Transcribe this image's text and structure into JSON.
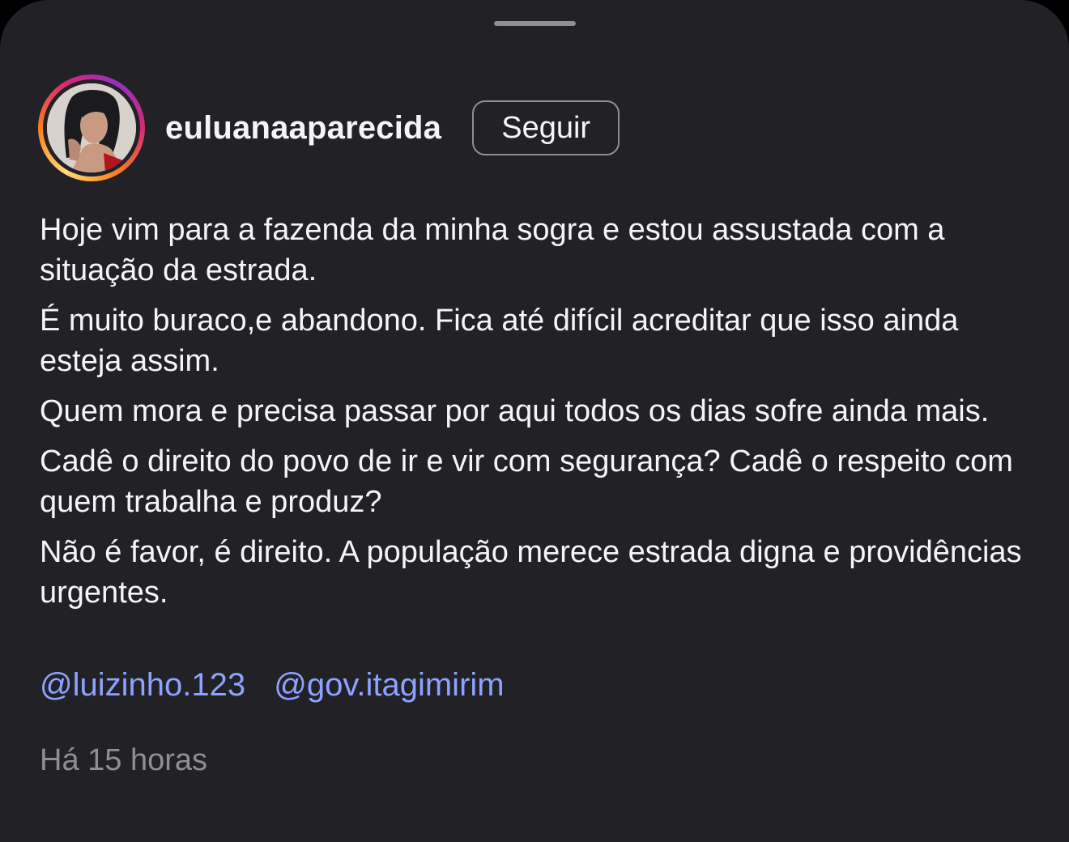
{
  "post": {
    "username": "euluanaaparecida",
    "follow_label": "Seguir",
    "caption": [
      "Hoje vim para a fazenda da minha sogra e estou assustada com a situação da estrada.",
      "É muito buraco,e abandono. Fica até difícil acreditar que isso ainda esteja assim.",
      "Quem mora e precisa passar por aqui todos os dias sofre ainda mais.",
      "Cadê o direito do povo de ir e vir com segurança? Cadê o respeito com quem trabalha e produz?",
      "Não é favor, é direito. A população merece estrada digna e providências urgentes."
    ],
    "mentions": [
      "@luizinho.123",
      "@gov.itagimirim"
    ],
    "timestamp": "Há 15 horas"
  },
  "colors": {
    "background": "#212126",
    "text": "#f5f5f5",
    "mention": "#8ea2ff",
    "muted": "#8e8e93"
  },
  "icons": {
    "grabber": "drag-handle",
    "avatar": "profile-photo"
  }
}
